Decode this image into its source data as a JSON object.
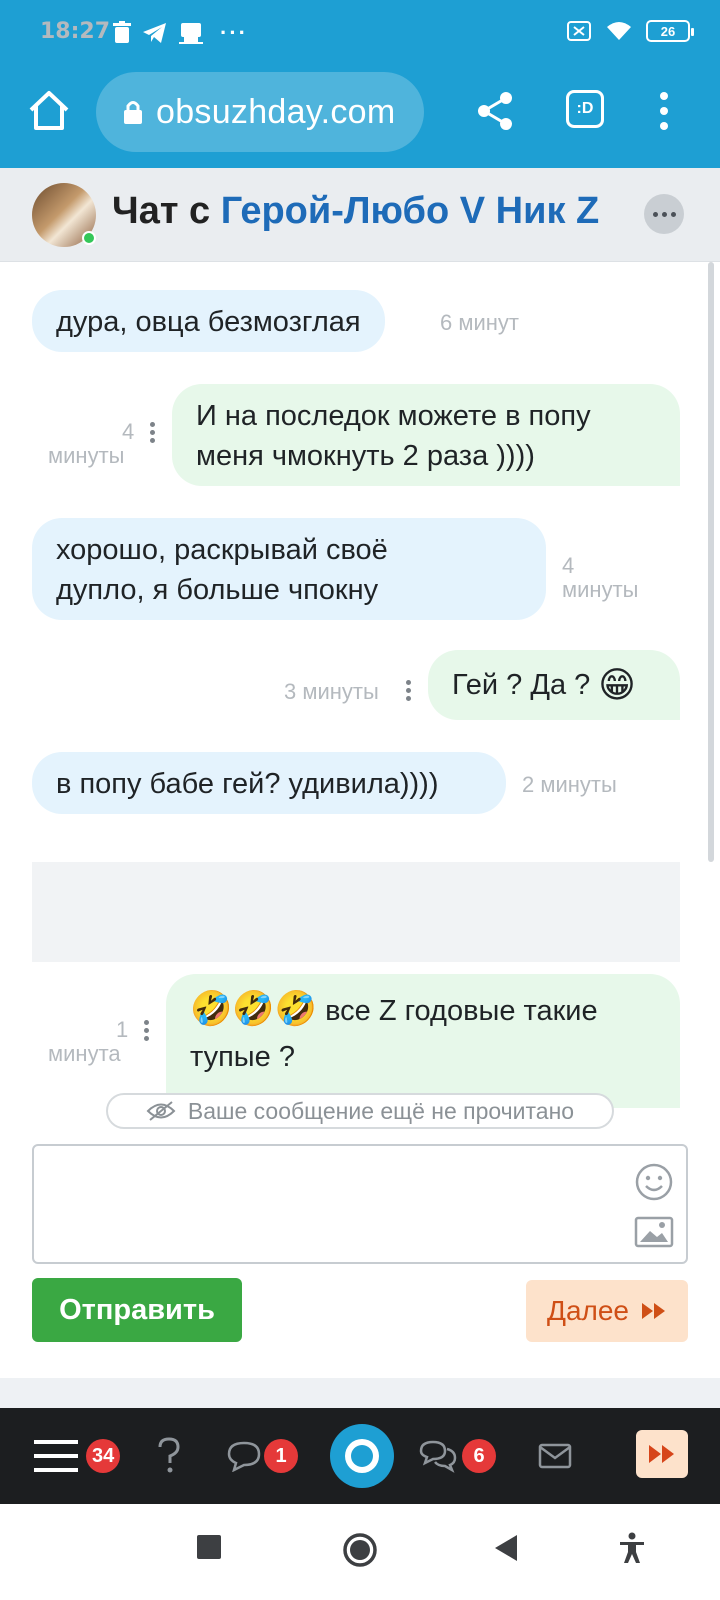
{
  "status_bar": {
    "time": "18:27",
    "battery": "26"
  },
  "browser": {
    "url": "obsuzhday.com",
    "tab_label": ":D"
  },
  "chat_header": {
    "prefix": "Чат с",
    "username": "Герой-Любо V Ник Z"
  },
  "messages": [
    {
      "side": "in",
      "text": "дура, овца безмозглая",
      "time": "6 минут"
    },
    {
      "side": "out",
      "line1": "И на последок можете в попу",
      "line2": "меня чмокнуть 2 раза ))))",
      "time_num": "4",
      "time_unit": "минуты"
    },
    {
      "side": "in",
      "line1": "хорошо, раскрывай своё",
      "line2": "дупло, я больше чпокну",
      "time_num": "4",
      "time_unit": "минуты"
    },
    {
      "side": "out",
      "text": "Гей ? Да ?",
      "emoji": "😁",
      "time": "3 минуты"
    },
    {
      "side": "in",
      "text": "в попу бабе гей? удивила))))",
      "time": "2 минуты"
    },
    {
      "side": "out",
      "emoji": "🤣🤣🤣",
      "line1": "все Z годовые такие",
      "line2": "тупые ?",
      "time_num": "1",
      "time_unit": "минута"
    }
  ],
  "unread_notice": "Ваше сообщение ещё не прочитано",
  "compose": {
    "value": "",
    "send_label": "Отправить",
    "next_label": "Далее"
  },
  "bottom_nav": {
    "menu_badge": "34",
    "chat_badge": "1",
    "chats_badge": "6"
  },
  "colors": {
    "brand": "#1e9fd3",
    "incoming_bubble": "#e4f3fd",
    "outgoing_bubble": "#e7f8ea",
    "send_button": "#3aa843",
    "next_button_bg": "#fde2cb",
    "badge": "#e53939",
    "username": "#1e6bb8"
  },
  "icons": [
    "home-icon",
    "lock-icon",
    "share-icon",
    "tabs-icon",
    "more-vertical-icon",
    "more-horizontal-icon",
    "smile-icon",
    "image-icon",
    "hidden-eye-icon",
    "hamburger-icon",
    "question-icon",
    "chat-bubble-icon",
    "site-logo-icon",
    "chats-icon",
    "mail-icon",
    "fast-forward-icon",
    "stop-square-icon",
    "home-circle-icon",
    "back-triangle-icon",
    "accessibility-icon"
  ]
}
